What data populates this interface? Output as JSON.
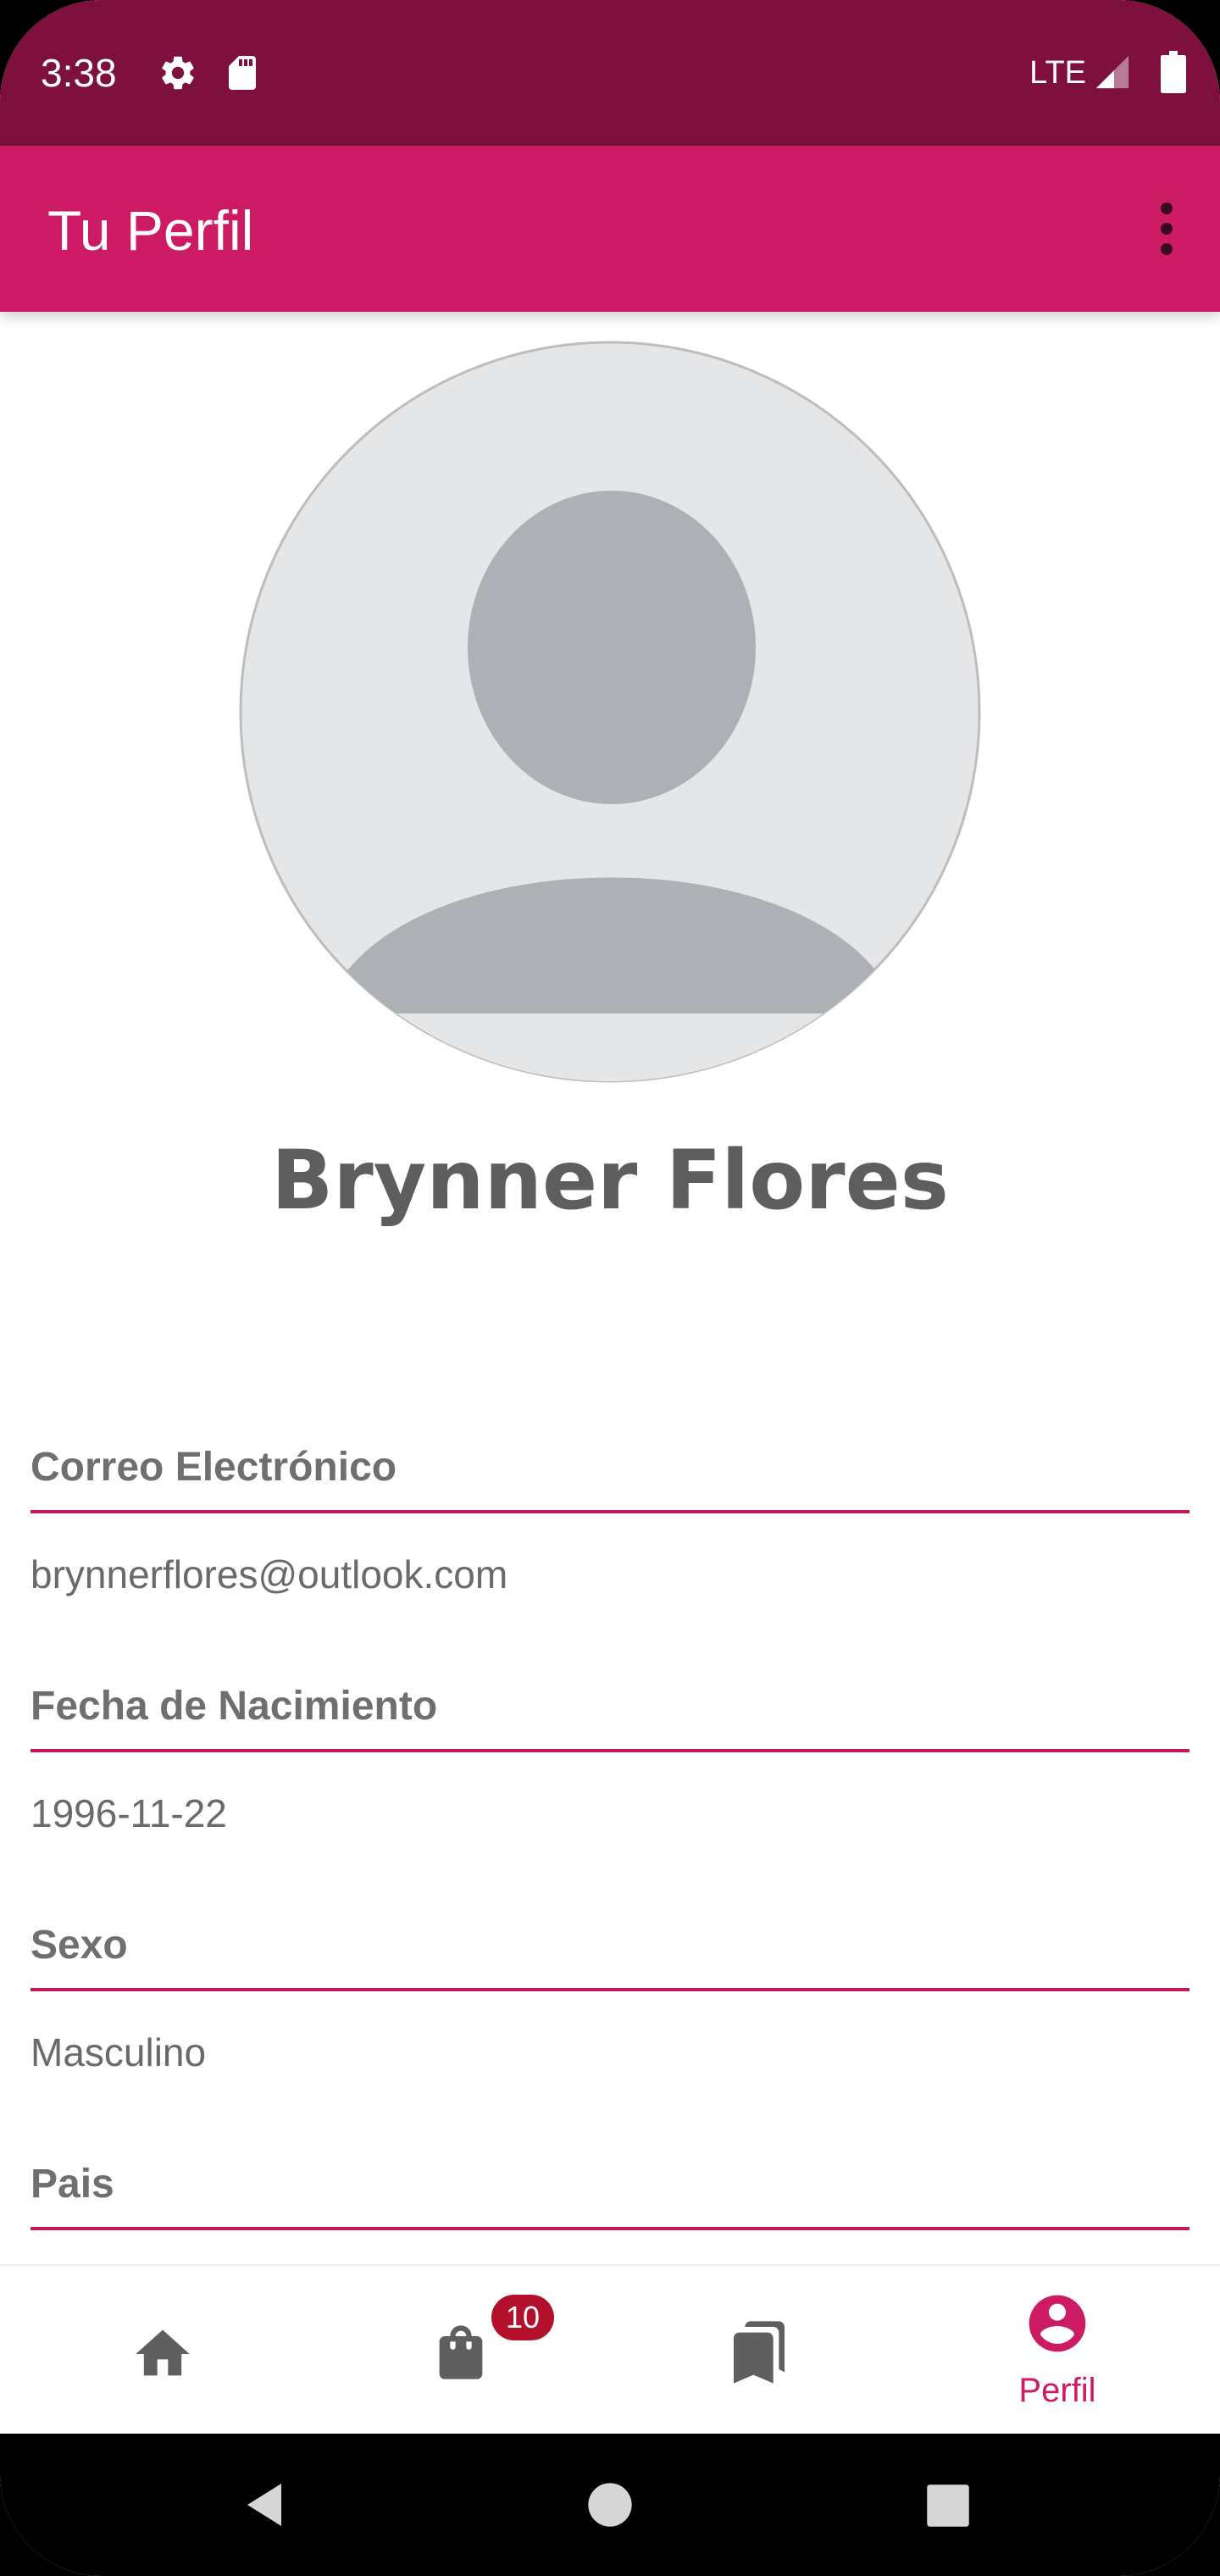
{
  "status_bar": {
    "time": "3:38",
    "network": "LTE",
    "icons": [
      "settings-gear-icon",
      "sd-card-icon",
      "cell-signal-icon",
      "battery-icon"
    ],
    "background_color": "#7e103e"
  },
  "app_bar": {
    "title": "Tu Perfil",
    "overflow_icon": "more-vert-icon",
    "background_color": "#cc1a64"
  },
  "profile": {
    "avatar_icon": "default-person-avatar-icon",
    "name": "Brynner Flores"
  },
  "fields": [
    {
      "label": "Correo Electrónico",
      "value": "brynnerflores@outlook.com"
    },
    {
      "label": "Fecha de Nacimiento",
      "value": "1996-11-22"
    },
    {
      "label": "Sexo",
      "value": "Masculino"
    },
    {
      "label": "Pais"
    }
  ],
  "bottom_nav": {
    "items": [
      {
        "icon": "home-icon"
      },
      {
        "icon": "shopping-bag-icon",
        "badge": "10"
      },
      {
        "icon": "bookmarks-icon"
      },
      {
        "icon": "account-circle-icon",
        "label": "Perfil",
        "selected": true
      }
    ],
    "accent_color": "#cc1a64",
    "badge_color": "#b3102b"
  },
  "system_nav": {
    "buttons": [
      "back-icon",
      "home-circle-icon",
      "recents-square-icon"
    ]
  }
}
